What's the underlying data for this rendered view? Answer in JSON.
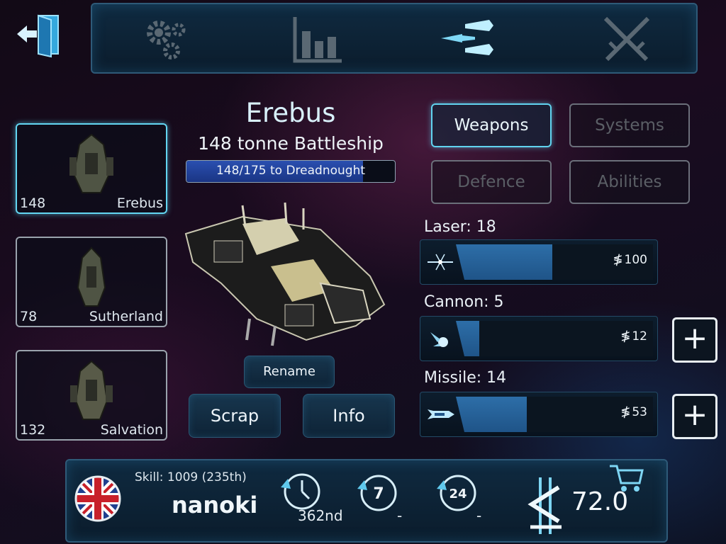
{
  "topbar": {
    "tabs": [
      {
        "name": "settings-gears-icon"
      },
      {
        "name": "stats-bar-chart-icon"
      },
      {
        "name": "fleet-ships-icon"
      },
      {
        "name": "battle-crossed-swords-icon"
      }
    ],
    "back_icon": "exit-door-icon"
  },
  "fleet": [
    {
      "number": "148",
      "name": "Erebus",
      "selected": true
    },
    {
      "number": "78",
      "name": "Sutherland",
      "selected": false
    },
    {
      "number": "132",
      "name": "Salvation",
      "selected": false
    }
  ],
  "ship": {
    "name": "Erebus",
    "class": "148 tonne Battleship",
    "progress_text": "148/175 to Dreadnought",
    "progress_fraction": 0.846,
    "rename_label": "Rename",
    "scrap_label": "Scrap",
    "info_label": "Info"
  },
  "categories": [
    {
      "label": "Weapons",
      "active": true
    },
    {
      "label": "Systems",
      "active": false
    },
    {
      "label": "Defence",
      "active": false
    },
    {
      "label": "Abilities",
      "active": false
    }
  ],
  "weapons": [
    {
      "label": "Laser: 18",
      "cost": "100",
      "fill_fraction": 0.49,
      "icon": "laser-icon",
      "upgrade": false
    },
    {
      "label": "Cannon: 5",
      "cost": "12",
      "fill_fraction": 0.12,
      "icon": "cannon-icon",
      "upgrade": true
    },
    {
      "label": "Missile: 14",
      "cost": "53",
      "fill_fraction": 0.36,
      "icon": "missile-icon",
      "upgrade": true
    }
  ],
  "player": {
    "skill": "Skill: 1009 (235th)",
    "name": "nanoki",
    "flag": "uk-flag-icon",
    "timers": [
      {
        "icon": "clock-icon",
        "value": "362nd"
      },
      {
        "icon": "seven-day-icon",
        "label": "7",
        "value": "-"
      },
      {
        "icon": "24-hour-icon",
        "label": "24",
        "value": "-"
      }
    ],
    "currency": "72.0",
    "currency_icon": "credits-icon",
    "shop_icon": "cart-icon"
  },
  "colors": {
    "accent": "#61d4f0",
    "panel": "#0f2a40",
    "bar_fill": "#2d6ea8",
    "progress_fill": "#2a4fb0"
  }
}
